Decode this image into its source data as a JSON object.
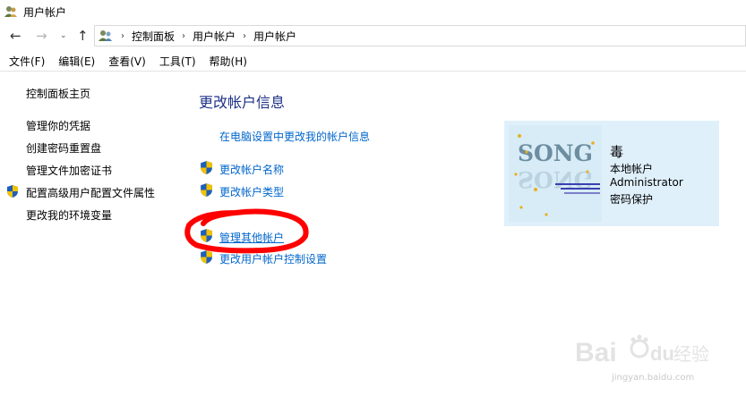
{
  "window": {
    "title": "用户帐户"
  },
  "nav": {
    "back": "←",
    "forward": "→",
    "dropdown": "⌄",
    "up": "↑"
  },
  "address": {
    "separator": "›",
    "crumbs": [
      "控制面板",
      "用户帐户",
      "用户帐户"
    ]
  },
  "menu": [
    "文件(F)",
    "编辑(E)",
    "查看(V)",
    "工具(T)",
    "帮助(H)"
  ],
  "sidebar": {
    "home": "控制面板主页",
    "items": [
      "管理你的凭据",
      "创建密码重置盘",
      "管理文件加密证书",
      "配置高级用户配置文件属性",
      "更改我的环境变量"
    ]
  },
  "main": {
    "title": "更改帐户信息",
    "pc_settings_link": "在电脑设置中更改我的帐户信息",
    "links": [
      "更改帐户名称",
      "更改帐户类型",
      "管理其他帐户",
      "更改用户帐户控制设置"
    ]
  },
  "account": {
    "avatar_text": "SONG",
    "name": "毒",
    "type": "本地帐户",
    "role": "Administrator",
    "protection": "密码保护"
  },
  "watermark": {
    "brand": "Bai",
    "brand_cn": "经验",
    "url": "jingyan.baidu.com"
  },
  "colors": {
    "link": "#0066cc",
    "title": "#1e3287",
    "card_bg": "#dff0fb",
    "highlight_circle": "#ff0000"
  },
  "icons": {
    "window": "users-icon",
    "shield": "uac-shield-icon",
    "address": "users-icon"
  }
}
